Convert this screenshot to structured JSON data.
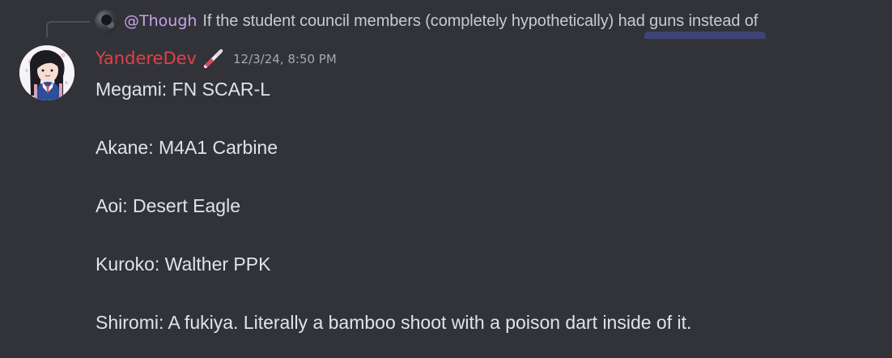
{
  "reply": {
    "author": "@Though",
    "preview": "If the student council members (completely hypothetically) had guns instead of"
  },
  "message": {
    "author": "YandereDev",
    "timestamp": "12/3/24, 8:50 PM",
    "lines": [
      "Megami: FN SCAR-L",
      "Akane: M4A1 Carbine",
      "Aoi: Desert Eagle",
      "Kuroko: Walther PPK",
      "Shiromi: A fukiya. Literally a bamboo shoot with a poison dart inside of it."
    ]
  },
  "colors": {
    "background": "#323339",
    "author": "#e14148",
    "reply_author": "#c8a2e8",
    "text": "#e1e3e7",
    "timestamp": "#a4a8b0"
  },
  "icons": {
    "reply_avatar": "avatar-icon",
    "author_role": "pen-icon",
    "author_avatar": "anime-avatar"
  }
}
